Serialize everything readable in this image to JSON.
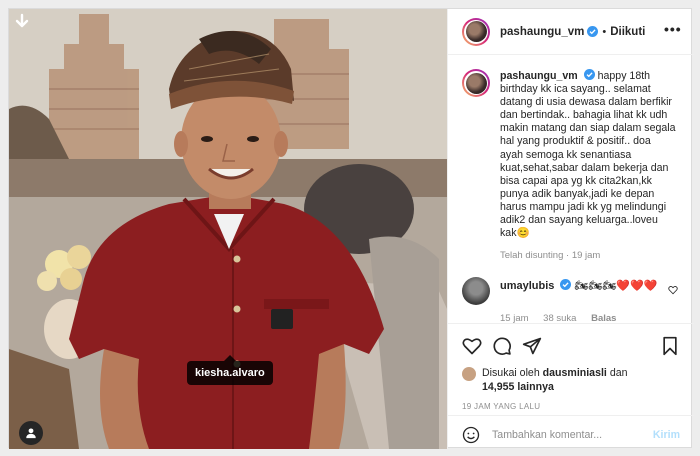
{
  "post": {
    "tagged_user": "kiesha.alvaro"
  },
  "header": {
    "username": "pashaungu_vm",
    "separator": "•",
    "follow_status": "Diikuti",
    "more_label": "•••"
  },
  "caption": {
    "username": "pashaungu_vm",
    "text": "happy 18th birthday kk ica sayang.. selamat datang di usia dewasa dalam berfikir dan bertindak.. bahagia lihat kk udh makin matang dan siap dalam segala hal yang produktif & positif.. doa ayah semoga kk senantiasa kuat,sehat,sabar dalam bekerja dan bisa capai apa yg kk cita2kan,kk punya adik banyak,jadi ke depan harus mampu jadi kk yg melindungi adik2 dan sayang keluarga..loveu kak😊",
    "meta": "Telah disunting · 19 jam"
  },
  "comments": [
    {
      "username": "umaylubis",
      "text": "🏍🏍🏍❤️❤️❤️",
      "time": "15 jam",
      "likes": "38 suka",
      "reply": "Balas"
    }
  ],
  "likes": {
    "prefix": "Disukai oleh",
    "user": "dausminiasli",
    "middle": "dan",
    "count": "14,955 lainnya"
  },
  "timestamp": "19 JAM YANG LALU",
  "comment_box": {
    "placeholder": "Tambahkan komentar...",
    "post_label": "Kirim"
  },
  "colors": {
    "verified": "#3897f0",
    "post_button_disabled": "#b2dffc",
    "muted_text": "#8e8e8e"
  }
}
